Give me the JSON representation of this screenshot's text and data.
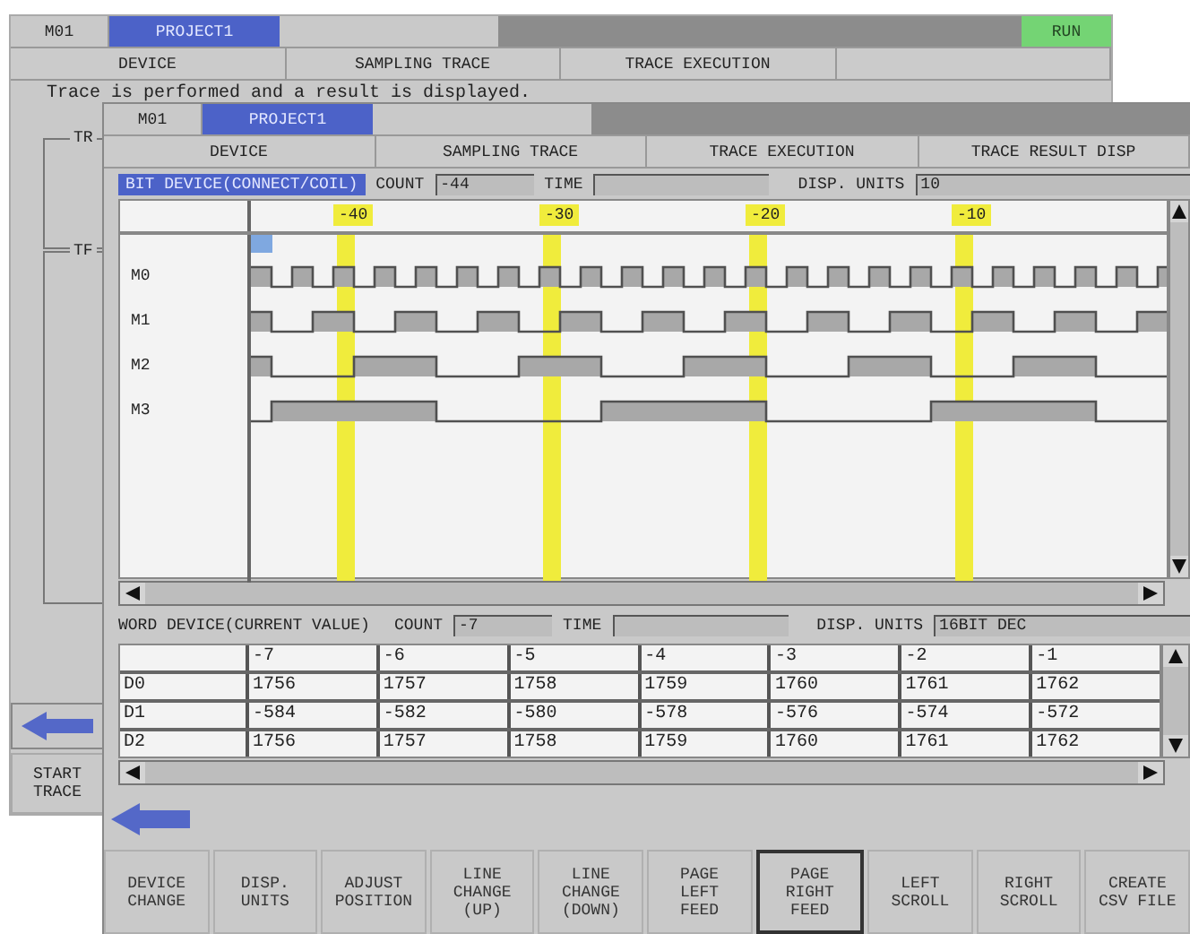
{
  "back_window": {
    "station": "M01",
    "project": "PROJECT1",
    "status": "RUN",
    "tabs": [
      "DEVICE",
      "SAMPLING TRACE",
      "TRACE EXECUTION"
    ],
    "message": "Trace is performed and a result is displayed.",
    "group_labels": [
      "TR",
      "TF"
    ],
    "start_button": "START\nTRACE"
  },
  "front_window": {
    "station": "M01",
    "project": "PROJECT1",
    "tabs": [
      "DEVICE",
      "SAMPLING TRACE",
      "TRACE EXECUTION",
      "TRACE RESULT DISP"
    ],
    "bit_panel": {
      "title": "BIT DEVICE(CONNECT/COIL)",
      "count_label": "COUNT",
      "count": "-44",
      "time_label": "TIME",
      "units_label": "DISP. UNITS",
      "units": "10",
      "markers": [
        "-40",
        "-30",
        "-20",
        "-10"
      ],
      "signals": [
        "M0",
        "M1",
        "M2",
        "M3"
      ]
    },
    "word_panel": {
      "title": "WORD DEVICE(CURRENT VALUE)",
      "count_label": "COUNT",
      "count": "-7",
      "time_label": "TIME",
      "units_label": "DISP. UNITS",
      "units": "16BIT DEC",
      "columns": [
        "-7",
        "-6",
        "-5",
        "-4",
        "-3",
        "-2",
        "-1"
      ],
      "rows": [
        {
          "device": "D0",
          "values": [
            "1756",
            "1757",
            "1758",
            "1759",
            "1760",
            "1761",
            "1762"
          ]
        },
        {
          "device": "D1",
          "values": [
            "-584",
            "-582",
            "-580",
            "-578",
            "-576",
            "-574",
            "-572"
          ]
        },
        {
          "device": "D2",
          "values": [
            "1756",
            "1757",
            "1758",
            "1759",
            "1760",
            "1761",
            "1762"
          ]
        }
      ]
    },
    "buttons": [
      {
        "label": "DEVICE\nCHANGE",
        "selected": false
      },
      {
        "label": "DISP.\nUNITS",
        "selected": false
      },
      {
        "label": "ADJUST\nPOSITION",
        "selected": false
      },
      {
        "label": "LINE\nCHANGE\n(UP)",
        "selected": false
      },
      {
        "label": "LINE\nCHANGE\n(DOWN)",
        "selected": false
      },
      {
        "label": "PAGE\nLEFT\nFEED",
        "selected": false
      },
      {
        "label": "PAGE\nRIGHT\nFEED",
        "selected": true
      },
      {
        "label": "LEFT\nSCROLL",
        "selected": false
      },
      {
        "label": "RIGHT\nSCROLL",
        "selected": false
      },
      {
        "label": "CREATE\nCSV FILE",
        "selected": false
      }
    ]
  }
}
